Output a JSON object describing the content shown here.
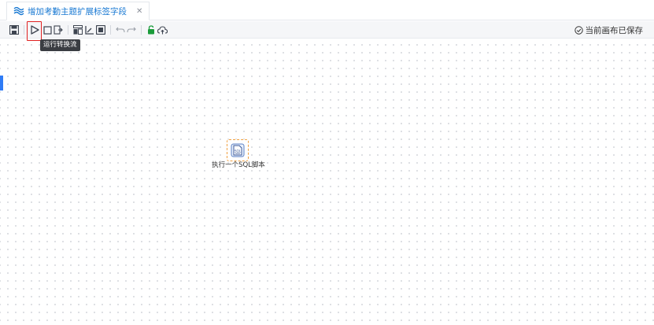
{
  "tab": {
    "title": "增加考勤主题扩展标签字段",
    "close_glyph": "✕",
    "icon": "flow-icon"
  },
  "toolbar": {
    "buttons": [
      {
        "name": "save-button",
        "icon": "save-icon"
      },
      {
        "name": "run-button",
        "icon": "play-icon"
      },
      {
        "name": "stop-button",
        "icon": "stop-icon"
      },
      {
        "name": "export-button",
        "icon": "export-icon"
      },
      {
        "name": "layout-button",
        "icon": "grid-icon"
      },
      {
        "name": "analyze-button",
        "icon": "chart-icon"
      },
      {
        "name": "fit-button",
        "icon": "fit-icon"
      },
      {
        "name": "undo-button",
        "icon": "undo-icon"
      },
      {
        "name": "redo-button",
        "icon": "redo-icon"
      },
      {
        "name": "lock-button",
        "icon": "lock-icon"
      },
      {
        "name": "publish-button",
        "icon": "cloud-upload-icon"
      }
    ],
    "status_text": "当前画布已保存",
    "status_icon": "check-circle-icon"
  },
  "tooltip": {
    "text": "运行转换流"
  },
  "canvas": {
    "nodes": [
      {
        "label": "执行一个SQL脚本",
        "icon": "sql-script-icon"
      }
    ]
  },
  "colors": {
    "accent": "#1677d2",
    "highlight": "#e02020",
    "node_border": "#f0a040",
    "marker": "#2f7cf6"
  }
}
